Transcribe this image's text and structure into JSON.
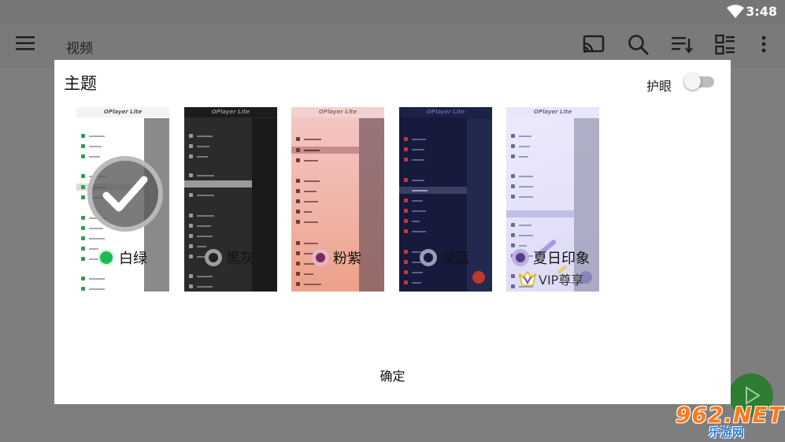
{
  "status": {
    "time": "3:48"
  },
  "appbar": {
    "title": "视频"
  },
  "dialog": {
    "title": "主题",
    "eye_protection_label": "护眼",
    "eye_protection_on": false,
    "confirm_label": "确定",
    "selected_theme_index": 0,
    "themes": [
      {
        "name": "白绿",
        "radio_color": "#1db954",
        "selected": true
      },
      {
        "name": "黑灰",
        "radio_color": "#222222",
        "selected": false
      },
      {
        "name": "粉紫",
        "radio_color": "#7b2a55",
        "selected": false
      },
      {
        "name": "深蓝",
        "radio_color": "#141a3a",
        "selected": false
      },
      {
        "name": "夏日印象",
        "radio_color": "#5b3a8e",
        "selected": false,
        "badge": "VIP尊享"
      }
    ],
    "preview_app_name": "OPlayer Lite"
  },
  "watermark": {
    "top": "962.NET",
    "bottom": "乐游网"
  },
  "colors": {
    "accent": "#2e7d32",
    "dialog_bg": "#ffffff",
    "scrim": "#7a7a7a"
  }
}
